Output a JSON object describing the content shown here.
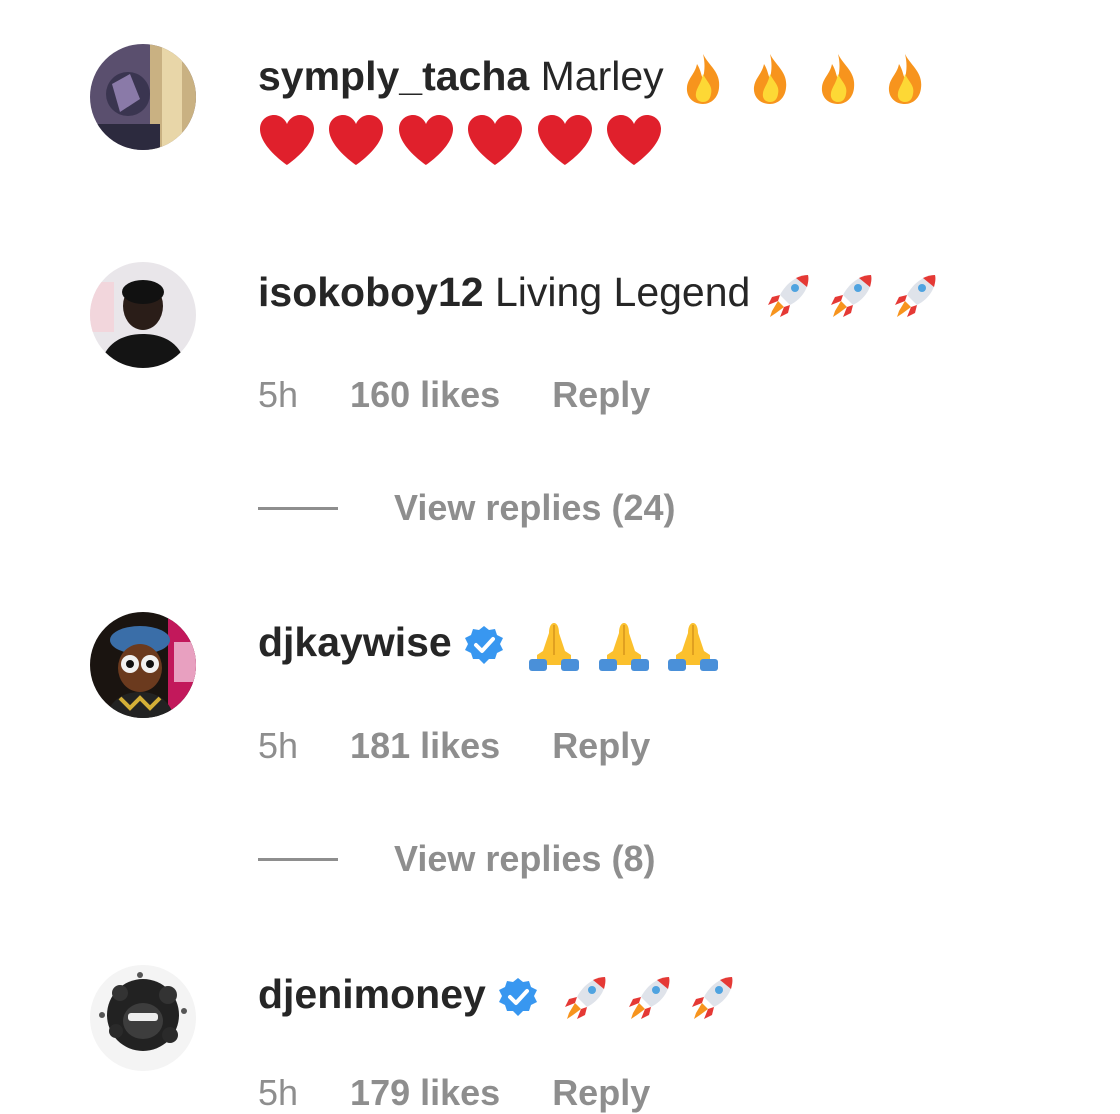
{
  "comments": [
    {
      "username": "symply_tacha",
      "text": "Marley",
      "emojis": [
        "fire-icon",
        "fire-icon",
        "fire-icon",
        "fire-icon",
        "heart-icon",
        "heart-icon",
        "heart-icon",
        "heart-icon",
        "heart-icon",
        "heart-icon"
      ]
    },
    {
      "username": "isokoboy12",
      "text": "Living Legend",
      "emojis": [
        "rocket-icon",
        "rocket-icon",
        "rocket-icon"
      ],
      "time": "5h",
      "likes": "160 likes",
      "reply": "Reply",
      "view_replies": "View replies (24)"
    },
    {
      "username": "djkaywise",
      "verified": true,
      "emojis": [
        "folded-hands-icon",
        "folded-hands-icon",
        "folded-hands-icon"
      ],
      "time": "5h",
      "likes": "181 likes",
      "reply": "Reply",
      "view_replies": "View replies (8)"
    },
    {
      "username": "djenimoney",
      "verified": true,
      "emojis": [
        "rocket-icon",
        "rocket-icon",
        "rocket-icon"
      ],
      "time": "5h",
      "likes": "179 likes",
      "reply": "Reply"
    }
  ],
  "colors": {
    "text": "#262626",
    "meta": "#8e8e8e",
    "verified": "#3897f0",
    "heart": "#e0202c",
    "fire": "#f7941d"
  }
}
